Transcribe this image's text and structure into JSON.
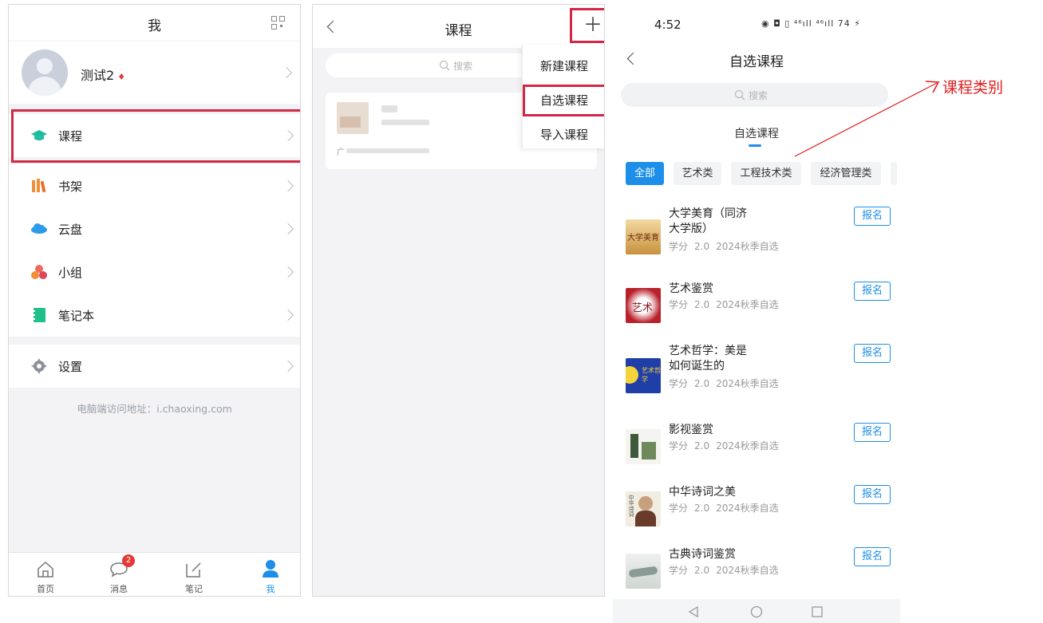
{
  "panel1": {
    "title": "我",
    "profile_name": "测试2",
    "profile_mark": "♦",
    "menu": [
      {
        "label": "课程",
        "icon": "graduation-cap-icon",
        "color": "#1ebc9c"
      },
      {
        "label": "书架",
        "icon": "books-icon",
        "color": "#f0903a"
      },
      {
        "label": "云盘",
        "icon": "cloud-icon",
        "color": "#2b9bea"
      },
      {
        "label": "小组",
        "icon": "group-icon",
        "color": "#ee6b5a"
      },
      {
        "label": "笔记本",
        "icon": "notebook-icon",
        "color": "#20c08b"
      },
      {
        "label": "设置",
        "icon": "gear-icon",
        "color": "#8a8f98"
      }
    ],
    "pc_address": "电脑端访问地址：i.chaoxing.com",
    "tabs": [
      {
        "label": "首页",
        "icon": "home-icon"
      },
      {
        "label": "消息",
        "icon": "message-icon",
        "badge": "2"
      },
      {
        "label": "笔记",
        "icon": "note-icon"
      },
      {
        "label": "我",
        "icon": "person-icon",
        "active": true
      }
    ]
  },
  "panel2": {
    "title": "课程",
    "search_placeholder": "搜索",
    "card_line": "广",
    "dropdown": [
      "新建课程",
      "自选课程",
      "导入课程"
    ]
  },
  "panel3": {
    "time": "4:52",
    "status_icons": "◉ ◘ ▯ ⁴⁶ıll ⁴⁶ıll 74 ⚡",
    "battery": "74",
    "title": "自选课程",
    "search_placeholder": "搜索",
    "segment": "自选课程",
    "categories": [
      "全部",
      "艺术类",
      "工程技术类",
      "经济管理类"
    ],
    "courses": [
      {
        "name": "大学美育（同济大学版）",
        "credit_label": "学分",
        "credit": "2.0",
        "term": "2024秋季自选",
        "action": "报名"
      },
      {
        "name": "艺术鉴赏",
        "credit_label": "学分",
        "credit": "2.0",
        "term": "2024秋季自选",
        "action": "报名"
      },
      {
        "name": "艺术哲学：美是如何诞生的",
        "credit_label": "学分",
        "credit": "2.0",
        "term": "2024秋季自选",
        "action": "报名"
      },
      {
        "name": "影视鉴赏",
        "credit_label": "学分",
        "credit": "2.0",
        "term": "2024秋季自选",
        "action": "报名"
      },
      {
        "name": "中华诗词之美",
        "credit_label": "学分",
        "credit": "2.0",
        "term": "2024秋季自选",
        "action": "报名"
      },
      {
        "name": "古典诗词鉴赏",
        "credit_label": "学分",
        "credit": "2.0",
        "term": "2024秋季自选",
        "action": "报名"
      }
    ],
    "thumb_texts": [
      "大学美育",
      "艺术",
      "艺术哲学",
      "",
      "中华诗词",
      ""
    ]
  },
  "annotation": {
    "text": "课程类别",
    "color": "#e02020"
  },
  "colors": {
    "accent": "#1d8fe8",
    "highlight": "#d02845"
  }
}
